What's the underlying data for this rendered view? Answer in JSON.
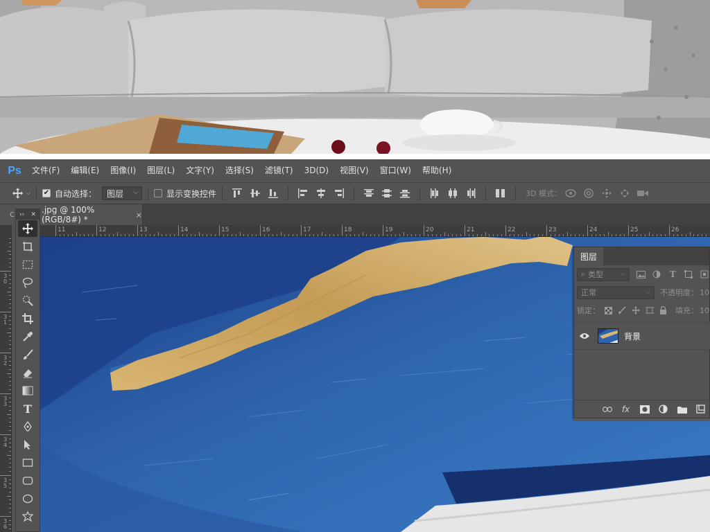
{
  "app": {
    "logo": "Ps",
    "menu": [
      "文件(F)",
      "编辑(E)",
      "图像(I)",
      "图层(L)",
      "文字(Y)",
      "选择(S)",
      "滤镜(T)",
      "3D(D)",
      "视图(V)",
      "窗口(W)",
      "帮助(H)"
    ]
  },
  "options_bar": {
    "auto_select_label": "自动选择：",
    "auto_select_checked": true,
    "auto_select_target": "图层",
    "show_transform_label": "显示变换控件",
    "show_transform_checked": false,
    "mode_3d_label": "3D 模式："
  },
  "document": {
    "tab_prefix": "c",
    "tab_title": ".jpg @ 100%(RGB/8#) *",
    "tab_close": "×"
  },
  "rulers": {
    "top_marks": [
      "11",
      "12",
      "13",
      "14",
      "15",
      "16",
      "17",
      "18",
      "19",
      "20",
      "21",
      "22",
      "23",
      "24",
      "25",
      "26"
    ],
    "left_marks": [
      "9",
      "3\n0",
      "3\n1",
      "3\n2",
      "3\n3",
      "3\n4",
      "3\n5",
      "3\n6"
    ]
  },
  "toolbox": {
    "header_left": "››",
    "header_right": "✕",
    "tools": [
      "move-icon",
      "artboard-icon",
      "marquee-icon",
      "lasso-icon",
      "quick-select-icon",
      "crop-icon",
      "eyedropper-icon",
      "brush-icon",
      "eraser-icon",
      "gradient-icon",
      "type-icon",
      "pen-icon",
      "path-select-icon",
      "rectangle-icon",
      "rounded-rect-icon",
      "ellipse-icon",
      "custom-shape-icon"
    ],
    "type_tool_glyph": "T"
  },
  "layers_panel": {
    "tab_label": "图层",
    "filter_label": "类型",
    "blend_mode": "正常",
    "opacity_label": "不透明度：",
    "opacity_value": "10",
    "lock_label": "锁定：",
    "fill_label": "填充：",
    "fill_value": "10",
    "layers": [
      {
        "name": "背景",
        "visible": true
      }
    ],
    "footer_fx": "fx"
  },
  "colors": {
    "ps_blue": "#4ea4ff",
    "panel_bg": "#535353",
    "canvas_blue": "#2f62a8",
    "canvas_navy": "#1c3f86",
    "gold": "#c9a15a"
  }
}
